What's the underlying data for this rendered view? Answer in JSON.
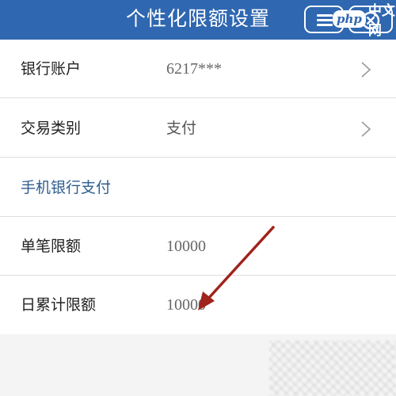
{
  "header": {
    "title": "个性化限额设置",
    "menu_icon": "hamburger-menu-icon",
    "close_icon": "close-circle-icon",
    "background_color": "#2f67b1"
  },
  "watermark": {
    "badge": "php",
    "text": "中文网"
  },
  "rows": [
    {
      "label": "银行账户",
      "value": "6217***",
      "has_chevron": true
    },
    {
      "label": "交易类别",
      "value": "支付",
      "has_chevron": true
    },
    {
      "section_title": "手机银行支付"
    },
    {
      "label": "单笔限额",
      "value": "10000"
    },
    {
      "label": "日累计限额",
      "value": "10000"
    }
  ],
  "annotation": {
    "arrow_color": "#a0231c",
    "arrow_icon": "red-arrow-pointer"
  }
}
